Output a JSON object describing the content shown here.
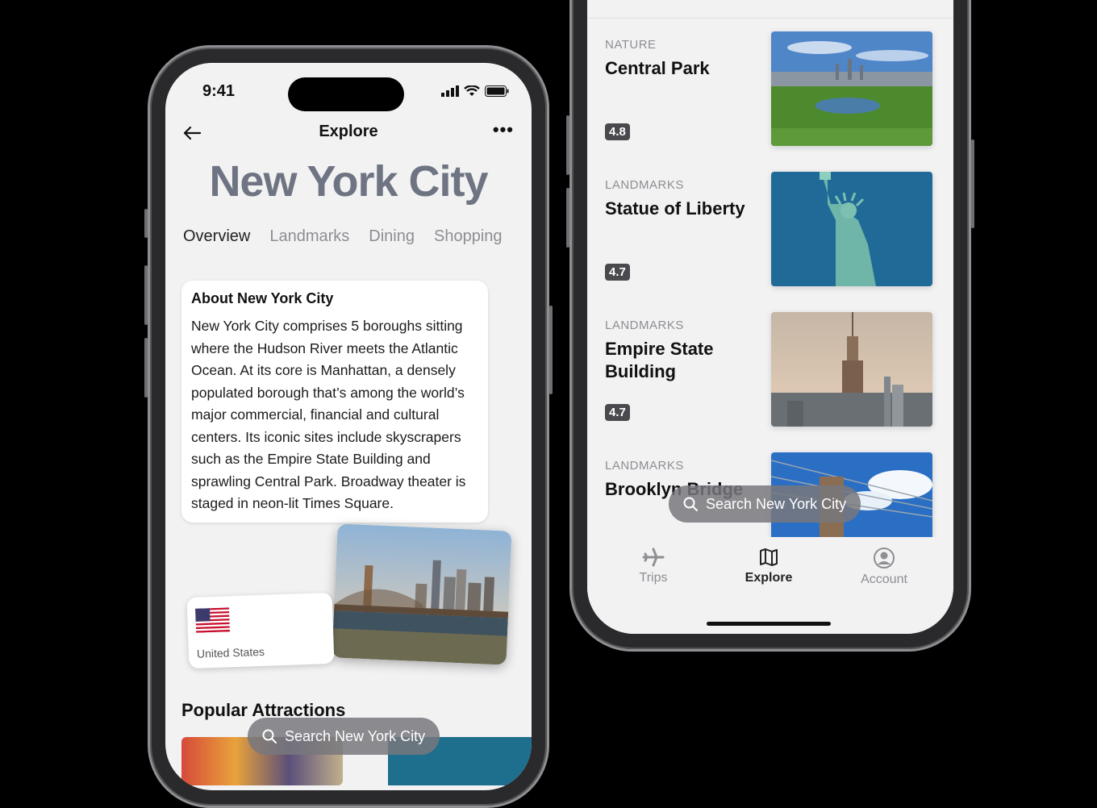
{
  "left_phone": {
    "status": {
      "time": "9:41"
    },
    "nav": {
      "title": "Explore"
    },
    "city_title": "New York City",
    "tabs": [
      "Overview",
      "Landmarks",
      "Dining",
      "Shopping"
    ],
    "about": {
      "title": "About New York City",
      "text": "New York City comprises 5 boroughs sitting where the Hudson River meets the Atlantic Ocean. At its core is Manhattan, a densely populated borough that’s among the world’s major commercial, financial and cultural centers. Its iconic sites include skyscrapers such as the Empire State Building and sprawling Central Park. Broadway theater is staged in neon-lit Times Square."
    },
    "country": {
      "name": "United States"
    },
    "popular_title": "Popular Attractions",
    "search_label": "Search New York City"
  },
  "right_phone": {
    "attractions": [
      {
        "category": "NATURE",
        "name": "Central Park",
        "rating": "4.8"
      },
      {
        "category": "LANDMARKS",
        "name": "Statue of Liberty",
        "rating": "4.7"
      },
      {
        "category": "LANDMARKS",
        "name": "Empire State Building",
        "rating": "4.7"
      },
      {
        "category": "LANDMARKS",
        "name": "Brooklyn Bridge",
        "rating": ""
      }
    ],
    "search_label": "Search New York City",
    "tabbar": [
      {
        "label": "Trips",
        "icon": "airplane-icon"
      },
      {
        "label": "Explore",
        "icon": "map-icon"
      },
      {
        "label": "Account",
        "icon": "person-circle-icon"
      }
    ]
  },
  "colors": {
    "title_gray": "#6e7482",
    "screen_bg": "#f2f2f3",
    "pill_bg": "#78787d"
  }
}
